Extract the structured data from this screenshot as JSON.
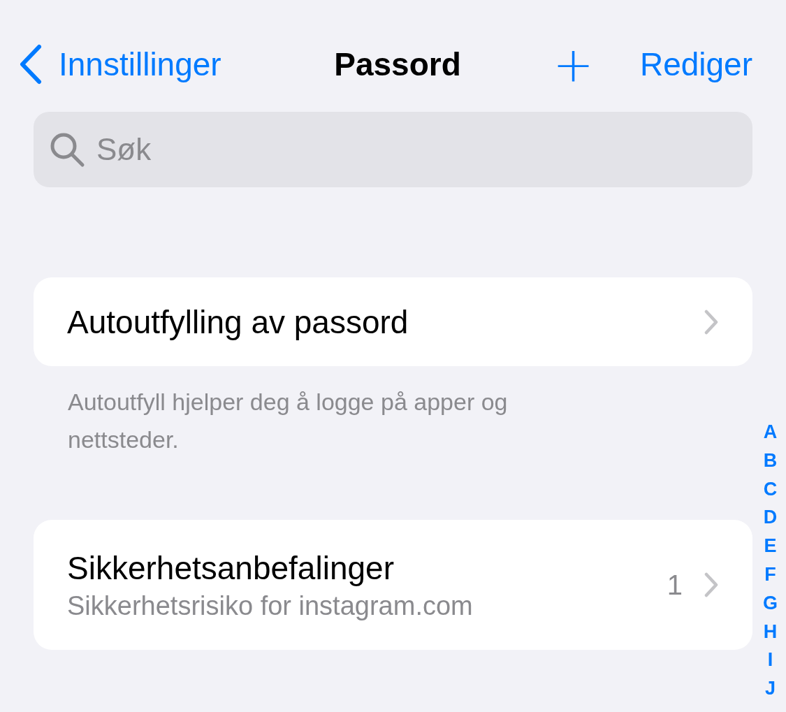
{
  "nav": {
    "back": "Innstillinger",
    "title": "Passord",
    "add": "+",
    "edit": "Rediger"
  },
  "search": {
    "placeholder": "Søk"
  },
  "sections": [
    {
      "rows": [
        {
          "title": "Autoutfylling av passord"
        }
      ],
      "footer": "Autoutfyll hjelper deg å logge på apper og nettsteder."
    },
    {
      "rows": [
        {
          "title": "Sikkerhetsanbefalinger",
          "subtitle": "Sikkerhetsrisiko for instagram.com",
          "count": "1"
        }
      ]
    }
  ],
  "index": [
    "A",
    "B",
    "C",
    "D",
    "E",
    "F",
    "G",
    "H",
    "I",
    "J"
  ]
}
